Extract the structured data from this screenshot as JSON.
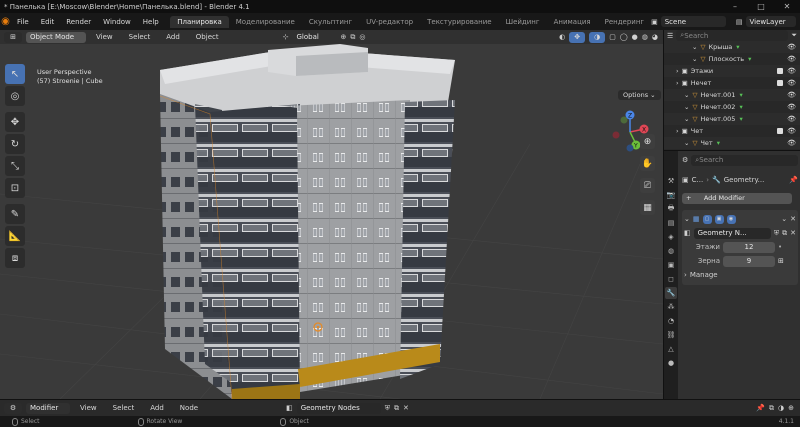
{
  "window": {
    "title": "* Панелька [E:\\Moscow\\Blender\\Home\\Панелька.blend] - Blender 4.1"
  },
  "menu": {
    "items": [
      "File",
      "Edit",
      "Render",
      "Window",
      "Help"
    ]
  },
  "workspaces": {
    "tabs": [
      "Планировка",
      "Моделирование",
      "Скульптинг",
      "UV-редактор",
      "Текстурирование",
      "Шейдинг",
      "Анимация",
      "Рендеринг"
    ],
    "active_index": 0
  },
  "scene": {
    "name": "Scene"
  },
  "view_layer": {
    "name": "ViewLayer"
  },
  "viewport_header": {
    "mode": "Object Mode",
    "menus": [
      "View",
      "Select",
      "Add",
      "Object"
    ],
    "transform": "Global"
  },
  "viewport": {
    "perspective": "User Perspective",
    "selection": "(57) Stroenie | Cube",
    "options": "Options"
  },
  "outliner": {
    "search_placeholder": "Search",
    "rows": [
      {
        "label": "Крыша",
        "icon": "mesh-orange",
        "indent": 3
      },
      {
        "label": "Плоскость",
        "icon": "mesh-orange",
        "indent": 3
      },
      {
        "label": "Этажи",
        "icon": "collection",
        "indent": 1
      },
      {
        "label": "Нечет",
        "icon": "collection",
        "indent": 1
      },
      {
        "label": "Нечет.001",
        "icon": "mesh-orange",
        "indent": 2
      },
      {
        "label": "Нечет.002",
        "icon": "mesh-orange",
        "indent": 2
      },
      {
        "label": "Нечет.005",
        "icon": "mesh-orange",
        "indent": 2
      },
      {
        "label": "Чет",
        "icon": "collection",
        "indent": 1
      },
      {
        "label": "Чет",
        "icon": "mesh-orange",
        "indent": 2
      },
      {
        "label": "Чет.001",
        "icon": "mesh-orange",
        "indent": 2
      }
    ]
  },
  "properties": {
    "search_placeholder": "Search",
    "breadcrumb_object": "C...",
    "breadcrumb_modifier": "Geometry...",
    "add_modifier": "Add Modifier",
    "modifier_name": "Geometry N...",
    "fields": [
      {
        "label": "Этажи",
        "value": "12"
      },
      {
        "label": "Зерна",
        "value": "9"
      }
    ],
    "manage": "Manage"
  },
  "node_editor": {
    "mode": "Modifier",
    "menus": [
      "View",
      "Select",
      "Add",
      "Node"
    ],
    "tree_name": "Geometry Nodes"
  },
  "status": {
    "select": "Select",
    "rotate": "Rotate View",
    "object": "Object",
    "version": "4.1.1"
  },
  "colors": {
    "accent": "#4772b3",
    "x_axis": "#e04655",
    "y_axis": "#6bbf3a",
    "z_axis": "#4a86e8"
  }
}
